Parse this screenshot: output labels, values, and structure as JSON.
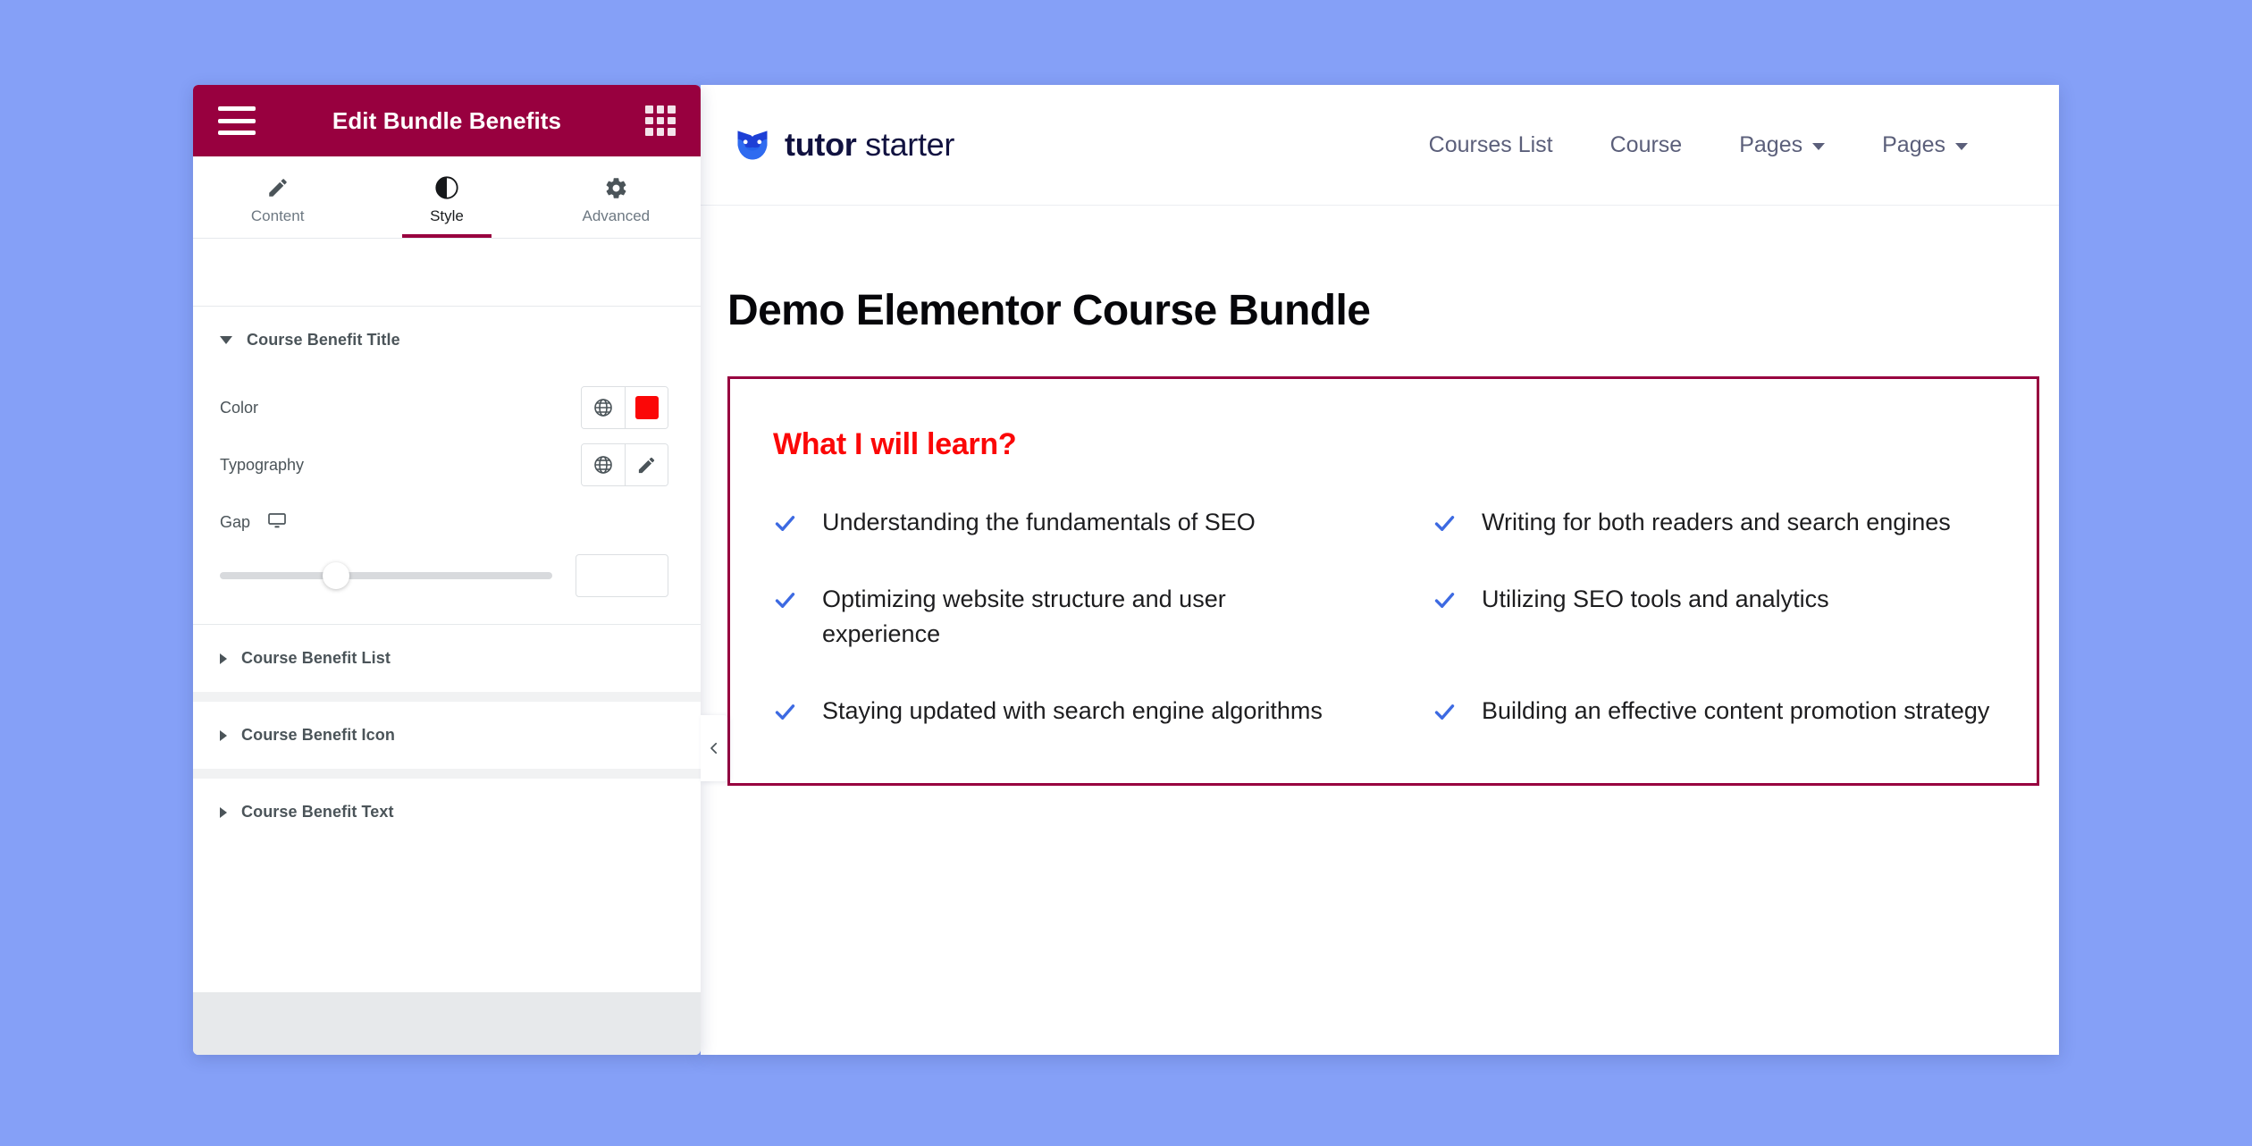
{
  "background_color": "#85a0f7",
  "editor": {
    "header": {
      "title": "Edit Bundle Benefits",
      "menu_icon": "hamburger-icon",
      "widgets_icon": "grid-apps-icon",
      "background_color": "#98003f"
    },
    "tabs": [
      {
        "label": "Content",
        "icon": "pencil-icon",
        "active": false
      },
      {
        "label": "Style",
        "icon": "contrast-icon",
        "active": true
      },
      {
        "label": "Advanced",
        "icon": "gear-icon",
        "active": false
      }
    ],
    "sections": [
      {
        "title": "Course Benefit Title",
        "expanded": true,
        "controls": [
          {
            "label": "Color",
            "type": "color",
            "globe_icon": "globe-icon",
            "value": "#fb0707"
          },
          {
            "label": "Typography",
            "type": "typography",
            "globe_icon": "globe-icon",
            "edit_icon": "pencil-icon"
          },
          {
            "label": "Gap",
            "type": "slider",
            "device_icon": "desktop-icon",
            "slider_percent": 35,
            "value": "",
            "placeholder": ""
          }
        ]
      },
      {
        "title": "Course Benefit List",
        "expanded": false,
        "controls": []
      },
      {
        "title": "Course Benefit Icon",
        "expanded": false,
        "controls": []
      },
      {
        "title": "Course Benefit Text",
        "expanded": false,
        "controls": []
      }
    ],
    "collapse_handle_icon": "chevron-left-icon"
  },
  "preview": {
    "brand": {
      "mark_icon": "owl-logo-icon",
      "name_bold": "tutor",
      "name_light": " starter",
      "color": "#111240"
    },
    "nav": [
      {
        "label": "Courses List",
        "has_dropdown": false
      },
      {
        "label": "Course",
        "has_dropdown": false
      },
      {
        "label": "Pages",
        "has_dropdown": true
      },
      {
        "label": "Pages",
        "has_dropdown": true
      }
    ],
    "page_title": "Demo Elementor Course Bundle",
    "benefits": {
      "heading": "What I will learn?",
      "heading_color": "#fb0707",
      "border_color": "#98003f",
      "check_icon": "check-icon",
      "check_color": "#3d6ae2",
      "items": [
        "Understanding the fundamentals of SEO",
        "Writing for both readers and search engines",
        "Optimizing website structure and user experience",
        "Utilizing SEO tools and analytics",
        "Staying updated with search engine algorithms",
        "Building an effective content promotion strategy"
      ]
    }
  }
}
